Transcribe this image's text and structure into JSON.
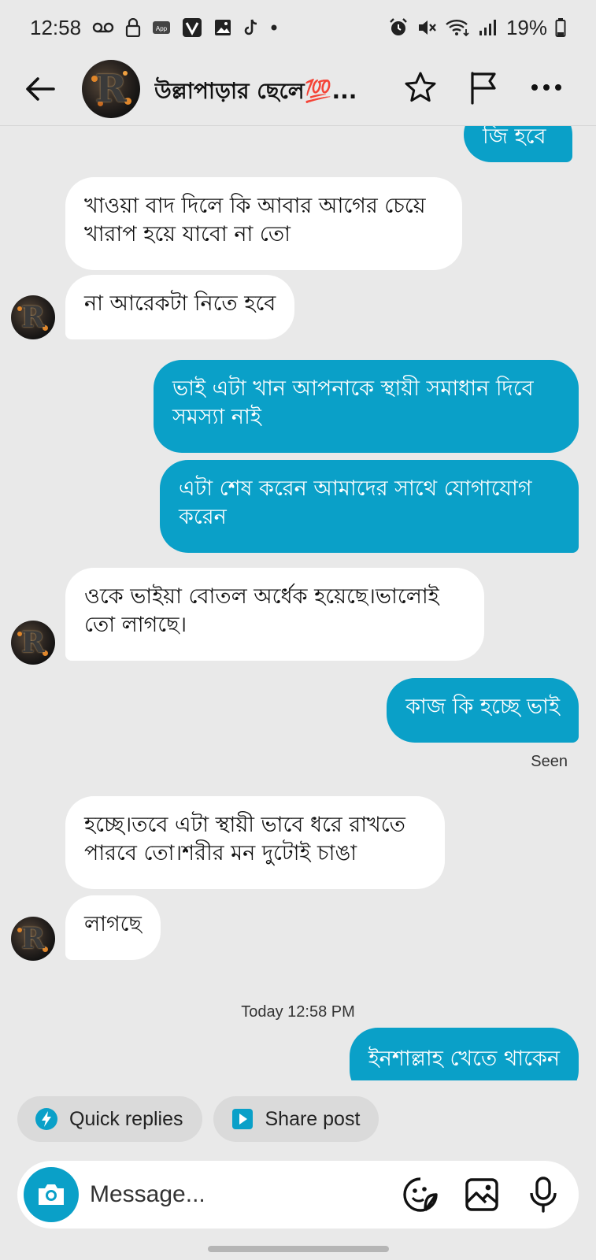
{
  "status_bar": {
    "time": "12:58",
    "battery": "19%",
    "left_icons": [
      "voicemail-icon",
      "lock-icon",
      "app-icon",
      "v-app-icon",
      "gallery-icon",
      "tiktok-icon",
      "dot-icon"
    ],
    "right_icons": [
      "alarm-icon",
      "mute-icon",
      "wifi-icon",
      "signal-icon",
      "battery-icon"
    ]
  },
  "header": {
    "title": "উল্লাপাড়ার ছেলে💯...",
    "avatar_letter": "R",
    "actions": [
      "star-icon",
      "flag-icon",
      "more-icon"
    ]
  },
  "messages": [
    {
      "side": "out",
      "text": "জি হবে"
    },
    {
      "side": "in",
      "text": "খাওয়া বাদ দিলে কি আবার আগের চেয়ে খারাপ হয়ে যাবো না তো"
    },
    {
      "side": "in",
      "text": "না আরেকটা নিতে হবে"
    },
    {
      "side": "out",
      "text": "ভাই এটা খান আপনাকে স্থায়ী সমাধান দিবে সমস্যা নাই"
    },
    {
      "side": "out",
      "text": "এটা শেষ করেন আমাদের সাথে যোগাযোগ করেন"
    },
    {
      "side": "in",
      "text": "ওকে ভাইয়া বোতল অর্ধেক হয়েছে।ভালোই তো লাগছে।"
    },
    {
      "side": "out",
      "text": "কাজ কি হচ্ছে ভাই"
    },
    {
      "side": "in",
      "text": "হচ্ছে।তবে এটা স্থায়ী ভাবে ধরে রাখতে পারবে তো।শরীর মন দুটোই চাঙা"
    },
    {
      "side": "in",
      "text": "লাগছে"
    },
    {
      "side": "out",
      "text": "ইনশাল্লাহ খেতে থাকেন"
    }
  ],
  "seen_label": "Seen",
  "timestamp": "Today 12:58 PM",
  "chips": {
    "quick_replies": "Quick replies",
    "share_post": "Share post"
  },
  "composer": {
    "placeholder": "Message...",
    "icons": [
      "camera-icon",
      "sticker-icon",
      "image-icon",
      "microphone-icon"
    ]
  },
  "colors": {
    "accent": "#0aa0c8",
    "background": "#e9e9e9",
    "incoming_bubble": "#ffffff"
  }
}
